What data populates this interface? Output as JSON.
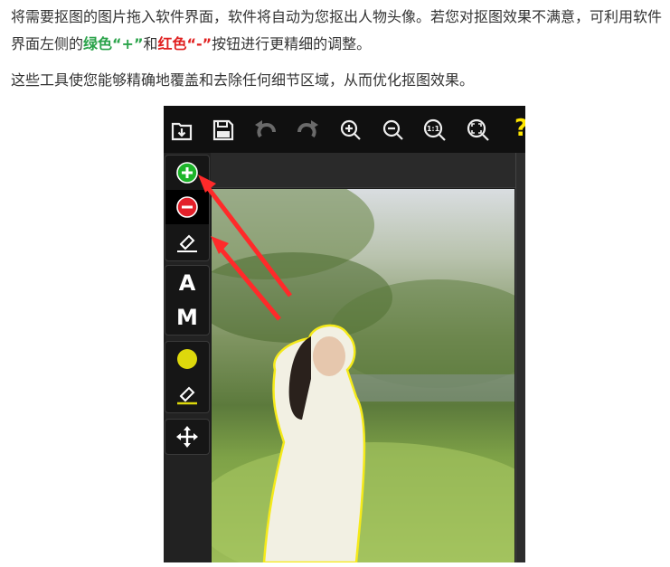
{
  "article": {
    "p1_a": "将需要抠图的图片拖入软件界面，软件将自动为您抠出人物头像。若您对抠图效果不满意，可利用软件界面左侧的",
    "p1_green": "绿色“+”",
    "p1_mid": "和",
    "p1_red": "红色“-”",
    "p1_b": "按钮进行更精细的调整。",
    "p2": "这些工具使您能够精确地覆盖和去除任何细节区域，从而优化抠图效果。"
  },
  "toolbar": {
    "zoom_reset_label": "1:1",
    "help_label": "?"
  },
  "sidebar": {
    "text_tool_label": "A",
    "manual_tool_label": "M"
  },
  "colors": {
    "add_green": "#1db42a",
    "remove_red": "#e3202a",
    "highlight_yellow": "#ddd80c",
    "arrow_red": "#ff2a2a"
  }
}
